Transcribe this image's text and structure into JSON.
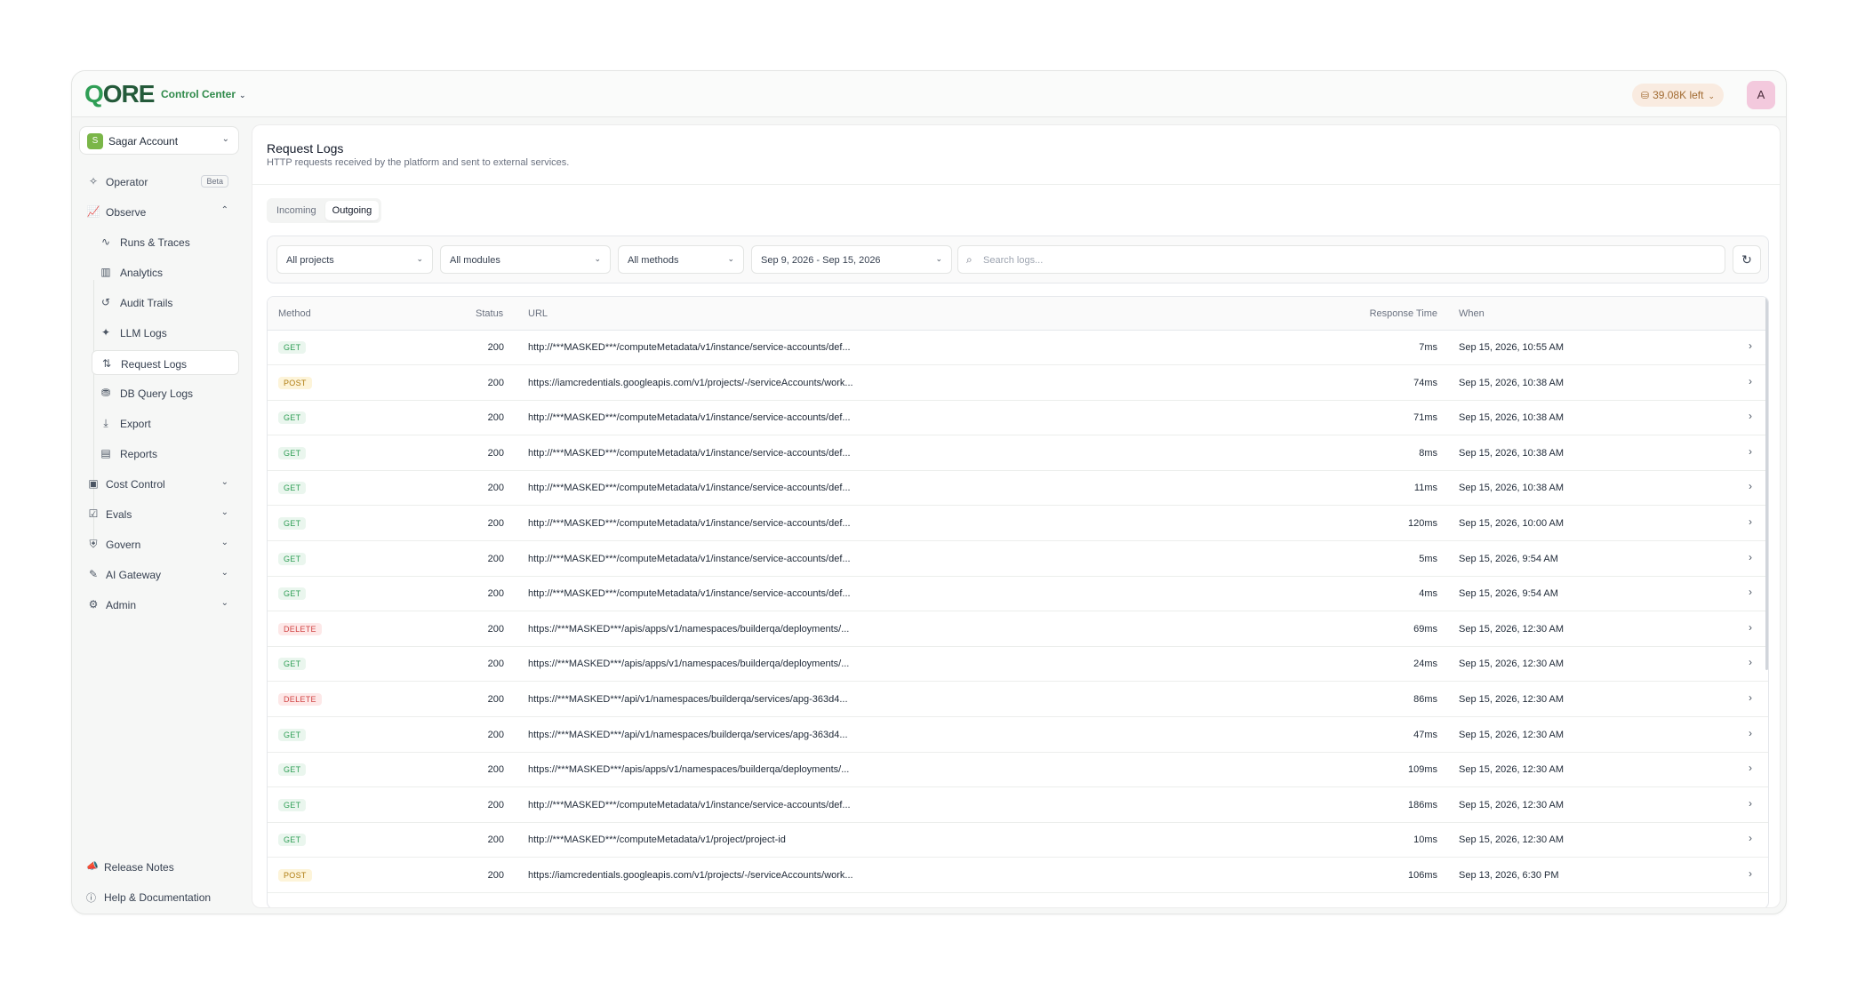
{
  "header": {
    "logo_q": "Q",
    "logo_rest": "ORE",
    "product": "Control Center",
    "credits": "39.08K left",
    "avatar": "A"
  },
  "sidebar": {
    "account": {
      "initial": "S",
      "name": "Sagar Account"
    },
    "items": [
      {
        "label": "Operator",
        "icon": "sparkle-icon",
        "tag": "Beta"
      },
      {
        "label": "Observe",
        "icon": "chart-line-icon"
      }
    ],
    "observe_children": [
      {
        "label": "Runs & Traces",
        "icon": "activity-icon"
      },
      {
        "label": "Analytics",
        "icon": "bar-chart-icon"
      },
      {
        "label": "Audit Trails",
        "icon": "history-icon"
      },
      {
        "label": "LLM Logs",
        "icon": "sparkle-icon"
      },
      {
        "label": "Request Logs",
        "icon": "arrows-up-down-icon"
      },
      {
        "label": "DB Query Logs",
        "icon": "database-icon"
      },
      {
        "label": "Export",
        "icon": "download-icon"
      },
      {
        "label": "Reports",
        "icon": "file-icon"
      }
    ],
    "groups": [
      {
        "label": "Cost Control",
        "icon": "wallet-icon"
      },
      {
        "label": "Evals",
        "icon": "clipboard-check-icon"
      },
      {
        "label": "Govern",
        "icon": "shield-icon"
      },
      {
        "label": "AI Gateway",
        "icon": "wand-icon"
      },
      {
        "label": "Admin",
        "icon": "users-cog-icon"
      }
    ],
    "footer": [
      {
        "label": "Release Notes",
        "icon": "megaphone-icon"
      },
      {
        "label": "Help & Documentation",
        "icon": "help-circle-icon"
      }
    ]
  },
  "main": {
    "title": "Request Logs",
    "subtitle": "HTTP requests received by the platform and sent to external services.",
    "tabs": [
      "Incoming",
      "Outgoing"
    ],
    "active_tab": "Outgoing",
    "filters": {
      "projects": "All projects",
      "modules": "All modules",
      "methods": "All methods",
      "date_range": "Sep 9, 2026 - Sep 15, 2026",
      "search_placeholder": "Search logs..."
    },
    "columns": [
      "Method",
      "Status",
      "URL",
      "Response Time",
      "When"
    ],
    "rows": [
      {
        "method": "GET",
        "status": "200",
        "url": "http://***MASKED***/computeMetadata/v1/instance/service-accounts/def...",
        "time": "7ms",
        "when": "Sep 15, 2026, 10:55 AM"
      },
      {
        "method": "POST",
        "status": "200",
        "url": "https://iamcredentials.googleapis.com/v1/projects/-/serviceAccounts/work...",
        "time": "74ms",
        "when": "Sep 15, 2026, 10:38 AM"
      },
      {
        "method": "GET",
        "status": "200",
        "url": "http://***MASKED***/computeMetadata/v1/instance/service-accounts/def...",
        "time": "71ms",
        "when": "Sep 15, 2026, 10:38 AM"
      },
      {
        "method": "GET",
        "status": "200",
        "url": "http://***MASKED***/computeMetadata/v1/instance/service-accounts/def...",
        "time": "8ms",
        "when": "Sep 15, 2026, 10:38 AM"
      },
      {
        "method": "GET",
        "status": "200",
        "url": "http://***MASKED***/computeMetadata/v1/instance/service-accounts/def...",
        "time": "11ms",
        "when": "Sep 15, 2026, 10:38 AM"
      },
      {
        "method": "GET",
        "status": "200",
        "url": "http://***MASKED***/computeMetadata/v1/instance/service-accounts/def...",
        "time": "120ms",
        "when": "Sep 15, 2026, 10:00 AM"
      },
      {
        "method": "GET",
        "status": "200",
        "url": "http://***MASKED***/computeMetadata/v1/instance/service-accounts/def...",
        "time": "5ms",
        "when": "Sep 15, 2026, 9:54 AM"
      },
      {
        "method": "GET",
        "status": "200",
        "url": "http://***MASKED***/computeMetadata/v1/instance/service-accounts/def...",
        "time": "4ms",
        "when": "Sep 15, 2026, 9:54 AM"
      },
      {
        "method": "DELETE",
        "status": "200",
        "url": "https://***MASKED***/apis/apps/v1/namespaces/builderqa/deployments/...",
        "time": "69ms",
        "when": "Sep 15, 2026, 12:30 AM"
      },
      {
        "method": "GET",
        "status": "200",
        "url": "https://***MASKED***/apis/apps/v1/namespaces/builderqa/deployments/...",
        "time": "24ms",
        "when": "Sep 15, 2026, 12:30 AM"
      },
      {
        "method": "DELETE",
        "status": "200",
        "url": "https://***MASKED***/api/v1/namespaces/builderqa/services/apg-363d4...",
        "time": "86ms",
        "when": "Sep 15, 2026, 12:30 AM"
      },
      {
        "method": "GET",
        "status": "200",
        "url": "https://***MASKED***/api/v1/namespaces/builderqa/services/apg-363d4...",
        "time": "47ms",
        "when": "Sep 15, 2026, 12:30 AM"
      },
      {
        "method": "GET",
        "status": "200",
        "url": "https://***MASKED***/apis/apps/v1/namespaces/builderqa/deployments/...",
        "time": "109ms",
        "when": "Sep 15, 2026, 12:30 AM"
      },
      {
        "method": "GET",
        "status": "200",
        "url": "http://***MASKED***/computeMetadata/v1/instance/service-accounts/def...",
        "time": "186ms",
        "when": "Sep 15, 2026, 12:30 AM"
      },
      {
        "method": "GET",
        "status": "200",
        "url": "http://***MASKED***/computeMetadata/v1/project/project-id",
        "time": "10ms",
        "when": "Sep 15, 2026, 12:30 AM"
      },
      {
        "method": "POST",
        "status": "200",
        "url": "https://iamcredentials.googleapis.com/v1/projects/-/serviceAccounts/work...",
        "time": "106ms",
        "when": "Sep 13, 2026, 6:30 PM"
      }
    ]
  },
  "colors": {
    "brand_green": "#2f9e55",
    "get": "#2f9e55",
    "post": "#b07d12",
    "delete": "#d14343"
  }
}
